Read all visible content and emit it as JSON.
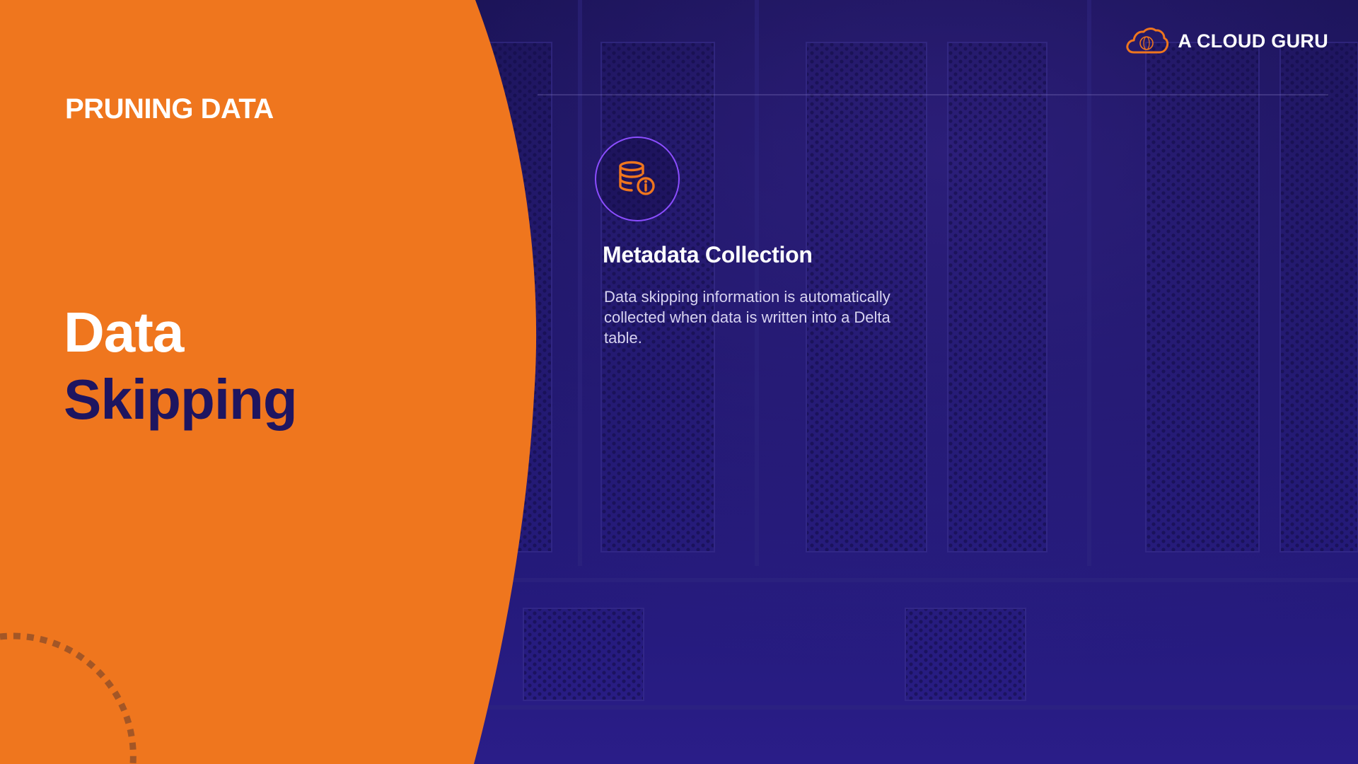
{
  "slide": {
    "section_label": "PRUNING DATA",
    "title_line_1": "Data",
    "title_line_2": "Skipping"
  },
  "brand": {
    "name": "A CLOUD GURU",
    "logo_icon": "cloud-logo-icon"
  },
  "card": {
    "icon": "database-info-icon",
    "title": "Metadata Collection",
    "body": "Data skipping information is automatically collected when data is written into a Delta table."
  },
  "colors": {
    "accent_orange": "#ef761e",
    "background_navy": "#1d1560",
    "title_navy": "#1e1560",
    "icon_ring_purple": "#8b4dff"
  }
}
